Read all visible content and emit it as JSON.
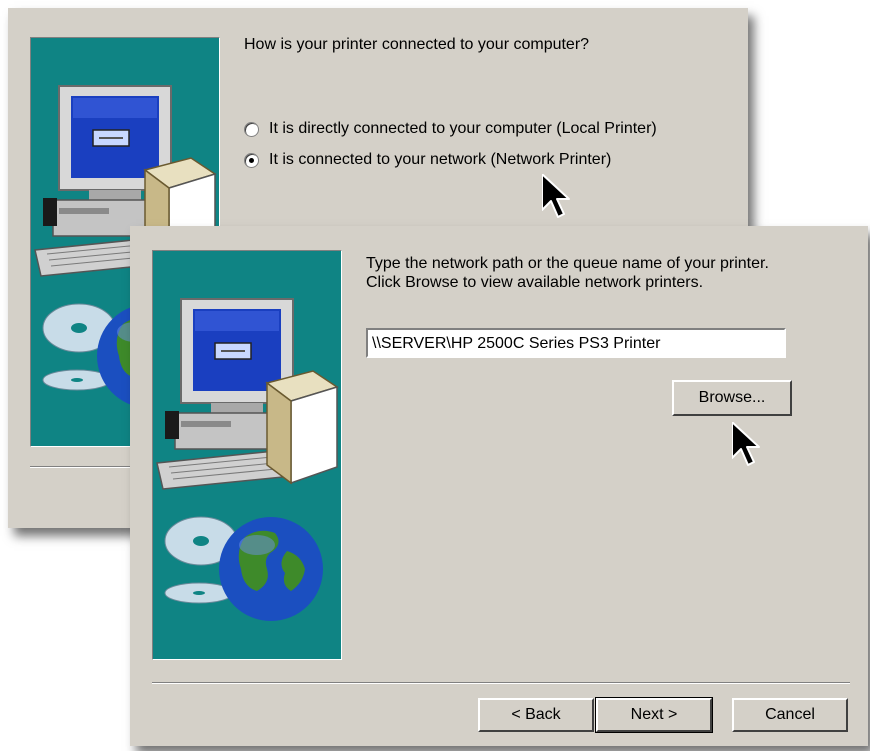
{
  "connection_page": {
    "question": "How is your printer connected to your computer?",
    "options": [
      {
        "label": "It is directly connected to your computer (Local Printer)",
        "selected": false
      },
      {
        "label": "It is connected to your network (Network Printer)",
        "selected": true
      }
    ]
  },
  "network_page": {
    "instruction_line1": "Type the network path or the queue name of your printer.",
    "instruction_line2": "Click Browse to view available network printers.",
    "path_value": "\\\\SERVER\\HP 2500C Series PS3 Printer",
    "browse_label": "Browse...",
    "back_label": "< Back",
    "next_label": "Next >",
    "cancel_label": "Cancel"
  },
  "icons": {
    "banner_art": "computer-printer-globe-cd-illustration",
    "pointer": "arrow-cursor-icon"
  },
  "colors": {
    "dialog_bg": "#d4d0c8",
    "banner_bg": "#0f8484"
  }
}
